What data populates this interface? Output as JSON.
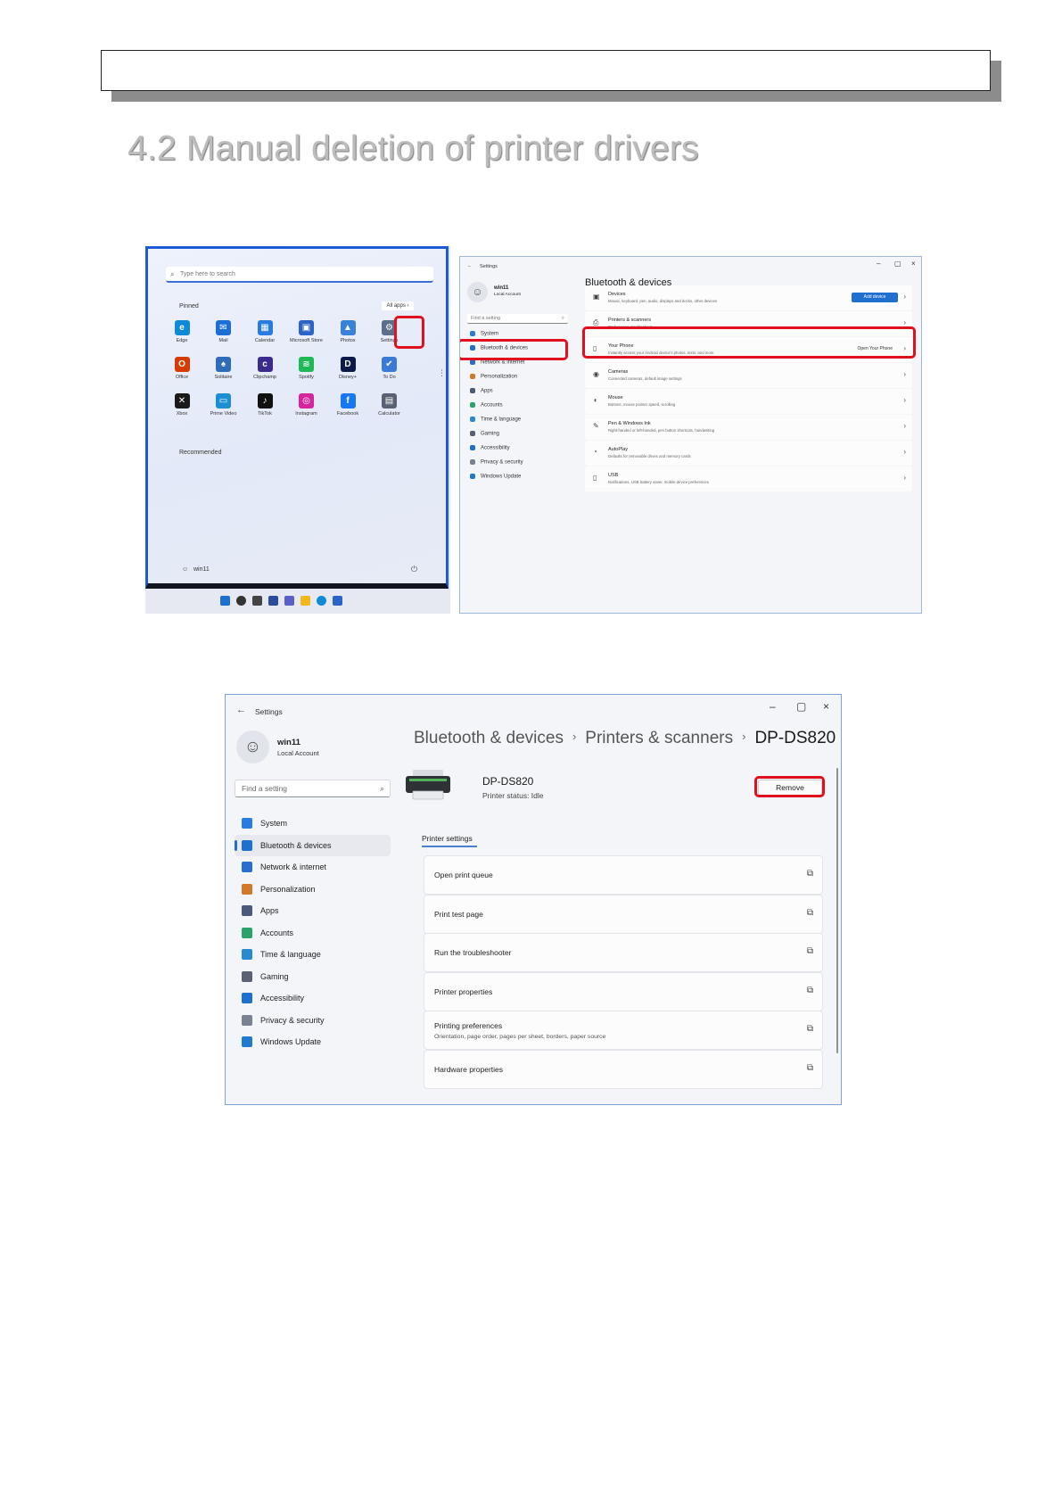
{
  "document": {
    "heading": "4.2 Manual deletion of printer drivers"
  },
  "start_menu": {
    "search_placeholder": "Type here to search",
    "pinned_label": "Pinned",
    "all_apps_label": "All apps",
    "recommended_label": "Recommended",
    "apps": [
      {
        "name": "Edge",
        "color": "#0f8bd6",
        "glyph": "e"
      },
      {
        "name": "Mail",
        "color": "#1d6fd8",
        "glyph": "✉"
      },
      {
        "name": "Calendar",
        "color": "#2a7be0",
        "glyph": "▦"
      },
      {
        "name": "Microsoft Store",
        "color": "#2b64c9",
        "glyph": "▣"
      },
      {
        "name": "Photos",
        "color": "#3a82d8",
        "glyph": "▲"
      },
      {
        "name": "Settings",
        "color": "#5b6f8a",
        "glyph": "⚙"
      },
      {
        "name": "Office",
        "color": "#d83b01",
        "glyph": "O"
      },
      {
        "name": "Solitaire",
        "color": "#2f6cb8",
        "glyph": "♠"
      },
      {
        "name": "Clipchamp",
        "color": "#3b2a8c",
        "glyph": "c"
      },
      {
        "name": "Spotify",
        "color": "#1db954",
        "glyph": "≋"
      },
      {
        "name": "Disney+",
        "color": "#0c1a4b",
        "glyph": "D"
      },
      {
        "name": "To Do",
        "color": "#3a7bd5",
        "glyph": "✔"
      },
      {
        "name": "Xbox",
        "color": "#1a1a1a",
        "glyph": "✕"
      },
      {
        "name": "Prime Video",
        "color": "#1b8fd1",
        "glyph": "▭"
      },
      {
        "name": "TikTok",
        "color": "#111111",
        "glyph": "♪"
      },
      {
        "name": "Instagram",
        "color": "#d6249f",
        "glyph": "◎"
      },
      {
        "name": "Facebook",
        "color": "#1877f2",
        "glyph": "f"
      },
      {
        "name": "Calculator",
        "color": "#5a6172",
        "glyph": "▤"
      }
    ],
    "user_name": "win11"
  },
  "bt_window": {
    "title": "Settings",
    "user_name": "win11",
    "user_sub": "Local Account",
    "find_placeholder": "Find a setting",
    "page_title": "Bluetooth & devices",
    "nav": [
      {
        "label": "System",
        "color": "#2a7be0"
      },
      {
        "label": "Bluetooth & devices",
        "color": "#1f6fd0"
      },
      {
        "label": "Network & internet",
        "color": "#2a6fd0"
      },
      {
        "label": "Personalization",
        "color": "#d07a2a"
      },
      {
        "label": "Apps",
        "color": "#4a5a78"
      },
      {
        "label": "Accounts",
        "color": "#2aa36a"
      },
      {
        "label": "Time & language",
        "color": "#2a8ad0"
      },
      {
        "label": "Gaming",
        "color": "#5a6172"
      },
      {
        "label": "Accessibility",
        "color": "#1f6fd0"
      },
      {
        "label": "Privacy & security",
        "color": "#7a8292"
      },
      {
        "label": "Windows Update",
        "color": "#1f7ad0"
      }
    ],
    "rows": [
      {
        "title": "Devices",
        "sub": "Mouse, keyboard, pen, audio, displays and docks, other devices",
        "icon": "▣",
        "action": "Add device"
      },
      {
        "title": "Printers & scanners",
        "sub": "Preferences, troubleshoot",
        "icon": "⎙",
        "action": ""
      },
      {
        "title": "Your Phone",
        "sub": "Instantly access your Android device's photos, texts, and more",
        "icon": "▯",
        "action": "Open Your Phone"
      },
      {
        "title": "Cameras",
        "sub": "Connected cameras, default image settings",
        "icon": "◉",
        "action": ""
      },
      {
        "title": "Mouse",
        "sub": "Buttons, mouse pointer speed, scrolling",
        "icon": "◖",
        "action": ""
      },
      {
        "title": "Pen & Windows Ink",
        "sub": "Right-handed or left-handed, pen button shortcuts, handwriting",
        "icon": "✎",
        "action": ""
      },
      {
        "title": "AutoPlay",
        "sub": "Defaults for removable drives and memory cards",
        "icon": "◔",
        "action": ""
      },
      {
        "title": "USB",
        "sub": "Notifications, USB battery saver, mobile device preferences",
        "icon": "▯",
        "action": ""
      }
    ]
  },
  "printer_window": {
    "title": "Settings",
    "user_name": "win11",
    "user_sub": "Local Account",
    "find_placeholder": "Find a setting",
    "breadcrumb": [
      "Bluetooth & devices",
      "Printers & scanners",
      "DP-DS820"
    ],
    "device_name": "DP-DS820",
    "device_status": "Printer status:   Idle",
    "remove_label": "Remove",
    "section_label": "Printer settings",
    "nav": [
      {
        "label": "System",
        "color": "#2a7be0"
      },
      {
        "label": "Bluetooth & devices",
        "color": "#1f6fd0"
      },
      {
        "label": "Network & internet",
        "color": "#2a6fd0"
      },
      {
        "label": "Personalization",
        "color": "#d07a2a"
      },
      {
        "label": "Apps",
        "color": "#4a5a78"
      },
      {
        "label": "Accounts",
        "color": "#2aa36a"
      },
      {
        "label": "Time & language",
        "color": "#2a8ad0"
      },
      {
        "label": "Gaming",
        "color": "#5a6172"
      },
      {
        "label": "Accessibility",
        "color": "#1f6fd0"
      },
      {
        "label": "Privacy & security",
        "color": "#7a8292"
      },
      {
        "label": "Windows Update",
        "color": "#1f7ad0"
      }
    ],
    "settings": [
      {
        "title": "Open print queue",
        "sub": ""
      },
      {
        "title": "Print test page",
        "sub": ""
      },
      {
        "title": "Run the troubleshooter",
        "sub": ""
      },
      {
        "title": "Printer properties",
        "sub": ""
      },
      {
        "title": "Printing preferences",
        "sub": "Orientation, page order, pages per sheet, borders, paper source"
      },
      {
        "title": "Hardware properties",
        "sub": ""
      }
    ]
  },
  "colors": {
    "highlight": "#e0101f",
    "accent": "#1f6fd0"
  }
}
